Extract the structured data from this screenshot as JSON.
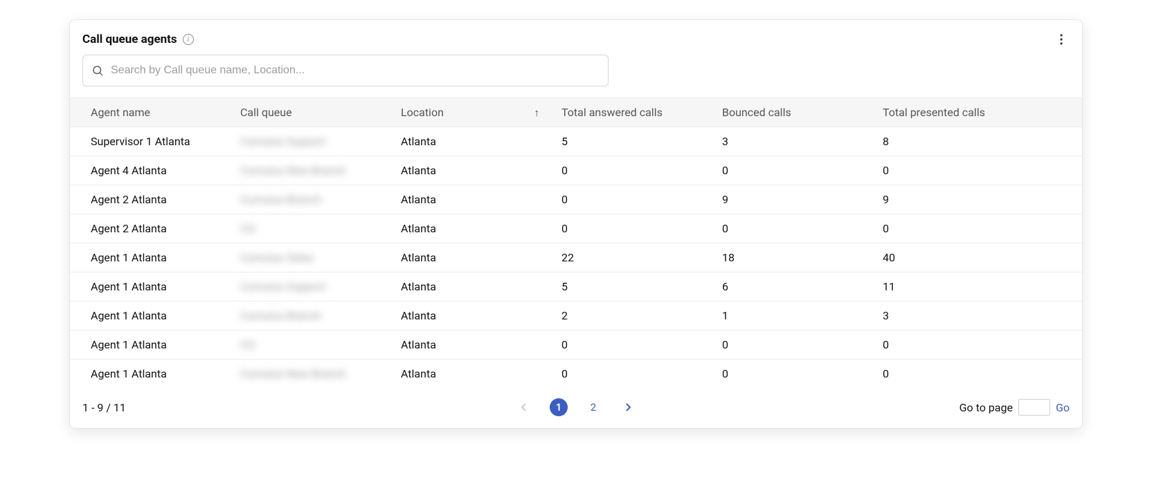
{
  "header": {
    "title": "Call queue agents"
  },
  "search": {
    "placeholder": "Search by Call queue name, Location..."
  },
  "columns": {
    "agent": "Agent name",
    "queue": "Call queue",
    "location": "Location",
    "answered": "Total answered calls",
    "bounced": "Bounced calls",
    "presented": "Total presented calls"
  },
  "sort": {
    "column": "location",
    "direction": "asc"
  },
  "rows": [
    {
      "agent": "Supervisor 1 Atlanta",
      "queue": "Cumulus Support",
      "location": "Atlanta",
      "answered": "5",
      "bounced": "3",
      "presented": "8"
    },
    {
      "agent": "Agent 4 Atlanta",
      "queue": "Cumulus New Branch",
      "location": "Atlanta",
      "answered": "0",
      "bounced": "0",
      "presented": "0"
    },
    {
      "agent": "Agent 2 Atlanta",
      "queue": "Cumulus Branch",
      "location": "Atlanta",
      "answered": "0",
      "bounced": "9",
      "presented": "9"
    },
    {
      "agent": "Agent 2 Atlanta",
      "queue": "CQ",
      "location": "Atlanta",
      "answered": "0",
      "bounced": "0",
      "presented": "0"
    },
    {
      "agent": "Agent 1 Atlanta",
      "queue": "Cumulus Sales",
      "location": "Atlanta",
      "answered": "22",
      "bounced": "18",
      "presented": "40"
    },
    {
      "agent": "Agent 1 Atlanta",
      "queue": "Cumulus Support",
      "location": "Atlanta",
      "answered": "5",
      "bounced": "6",
      "presented": "11"
    },
    {
      "agent": "Agent 1 Atlanta",
      "queue": "Cumulus Branch",
      "location": "Atlanta",
      "answered": "2",
      "bounced": "1",
      "presented": "3"
    },
    {
      "agent": "Agent 1 Atlanta",
      "queue": "CQ",
      "location": "Atlanta",
      "answered": "0",
      "bounced": "0",
      "presented": "0"
    },
    {
      "agent": "Agent 1 Atlanta",
      "queue": "Cumulus New Branch",
      "location": "Atlanta",
      "answered": "0",
      "bounced": "0",
      "presented": "0"
    }
  ],
  "pagination": {
    "range": "1 - 9 / 11",
    "pages": [
      "1",
      "2"
    ],
    "current": "1",
    "goto_label": "Go to page",
    "go_label": "Go"
  }
}
